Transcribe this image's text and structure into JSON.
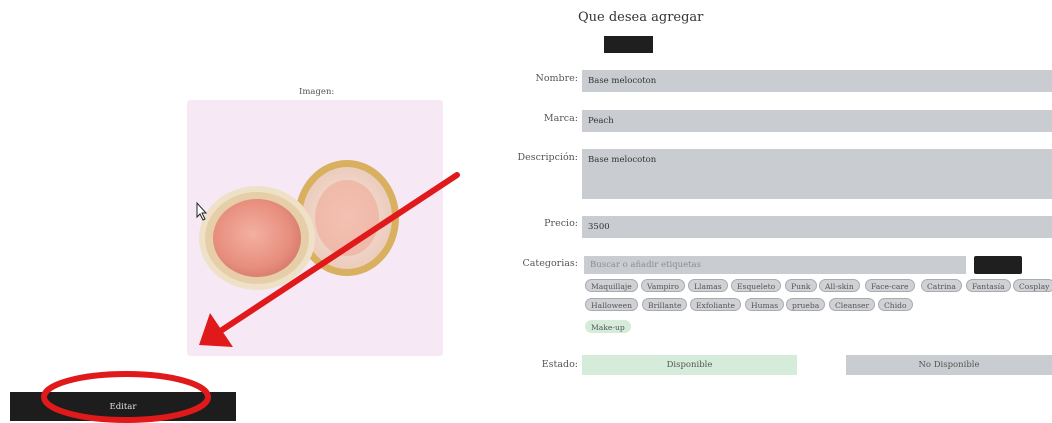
{
  "form": {
    "title": "Que desea agregar",
    "labels": {
      "nombre": "Nombre:",
      "marca": "Marca:",
      "descripcion": "Descripción:",
      "precio": "Precio:",
      "categorias": "Categorias:",
      "estado": "Estado:"
    },
    "values": {
      "nombre": "Base melocoton",
      "marca": "Peach",
      "descripcion": "Base melocoton",
      "precio": "3500"
    },
    "categorias_placeholder": "Buscar o añadir etiquetas",
    "tags_row1": [
      "Maquillaje",
      "Vampiro",
      "Llamas",
      "Esqueleto",
      "Punk",
      "All-skin",
      "Face-care",
      "Catrina",
      "Fantasía",
      "Cosplay"
    ],
    "tags_row2": [
      "Halloween",
      "Brillante",
      "Exfoliante",
      "Humas",
      "prueba",
      "Cleanser",
      "Chido"
    ],
    "selected_tags": [
      "Make-up"
    ],
    "estado_options": [
      "Disponible",
      "No Disponible"
    ]
  },
  "image": {
    "label": "Imagen:"
  },
  "actions": {
    "edit_label": "Editar"
  },
  "colors": {
    "field_bg": "#c9ccd0",
    "available": "#d4ecd9",
    "annotation": "#e0191b",
    "image_bg": "#f7e8f5"
  }
}
